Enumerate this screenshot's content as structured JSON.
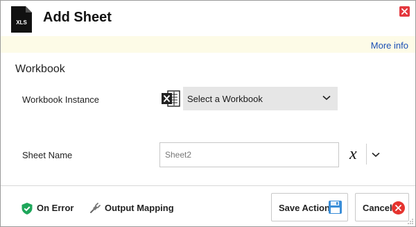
{
  "header": {
    "title": "Add Sheet",
    "file_icon_text": "XLS",
    "icons": {
      "file": "xls-file-icon",
      "close": "close-icon"
    }
  },
  "info_strip": {
    "more_info": "More info"
  },
  "section": {
    "title": "Workbook"
  },
  "fields": {
    "workbook_instance": {
      "label": "Workbook Instance",
      "value": "Select a Workbook",
      "icon": "excel-icon"
    },
    "sheet_name": {
      "label": "Sheet Name",
      "value": "Sheet2",
      "variable_symbol": "x"
    }
  },
  "footer": {
    "on_error": "On Error",
    "output_mapping": "Output Mapping",
    "save_action": "Save Action",
    "cancel": "Cancel",
    "icons": {
      "on_error": "shield-check-icon",
      "output_mapping": "plug-icon",
      "save": "floppy-disk-icon",
      "cancel": "x-circle-icon"
    }
  },
  "colors": {
    "close_red": "#e4383f",
    "info_strip_bg": "#fdfbe7",
    "link_blue": "#1a4fb5",
    "select_bg": "#e6e6e6",
    "shield_green": "#1ea65a",
    "cancel_red": "#e5342f",
    "floppy_blue": "#3a8ed8"
  }
}
